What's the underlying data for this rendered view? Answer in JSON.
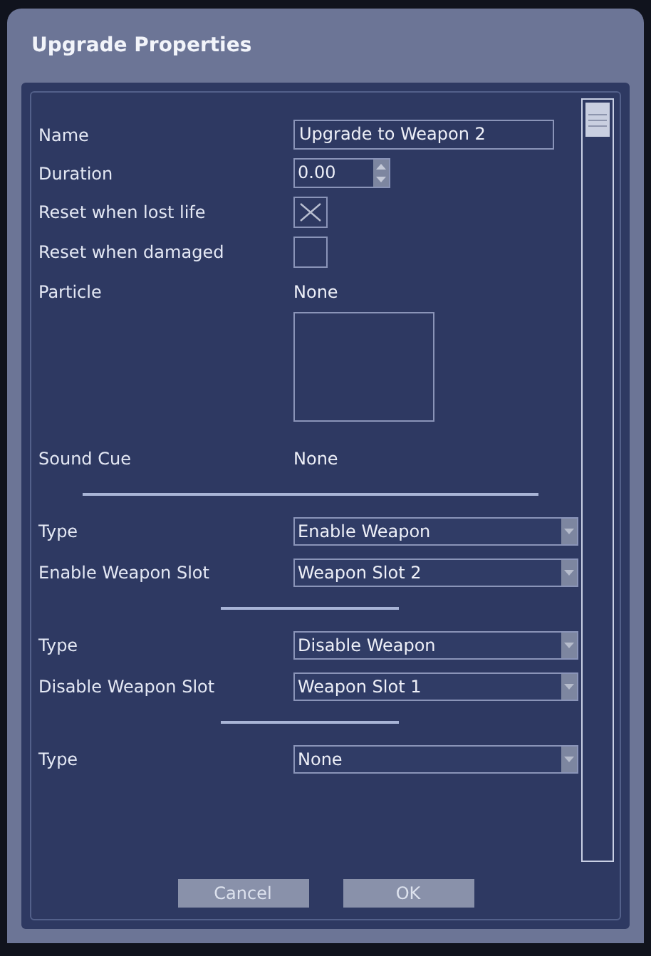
{
  "window": {
    "title": "Upgrade Properties"
  },
  "fields": [
    {
      "kind": "text",
      "label": "Name",
      "value": "Upgrade to Weapon 2"
    },
    {
      "kind": "spinner",
      "label": "Duration",
      "value": "0.00"
    },
    {
      "kind": "checkbox",
      "label": "Reset when lost life",
      "checked": true
    },
    {
      "kind": "checkbox",
      "label": "Reset when damaged",
      "checked": false
    },
    {
      "kind": "asset",
      "label": "Particle",
      "value": "None",
      "preview": true
    },
    {
      "kind": "asset",
      "label": "Sound Cue",
      "value": "None",
      "preview": false
    }
  ],
  "sections": [
    {
      "fields": [
        {
          "label": "Type",
          "value": "Enable Weapon"
        },
        {
          "label": "Enable Weapon Slot",
          "value": "Weapon Slot 2"
        }
      ]
    },
    {
      "fields": [
        {
          "label": "Type",
          "value": "Disable Weapon"
        },
        {
          "label": "Disable Weapon Slot",
          "value": "Weapon Slot 1"
        }
      ]
    },
    {
      "fields": [
        {
          "label": "Type",
          "value": "None"
        }
      ]
    }
  ],
  "buttons": [
    "Cancel",
    "OK"
  ]
}
